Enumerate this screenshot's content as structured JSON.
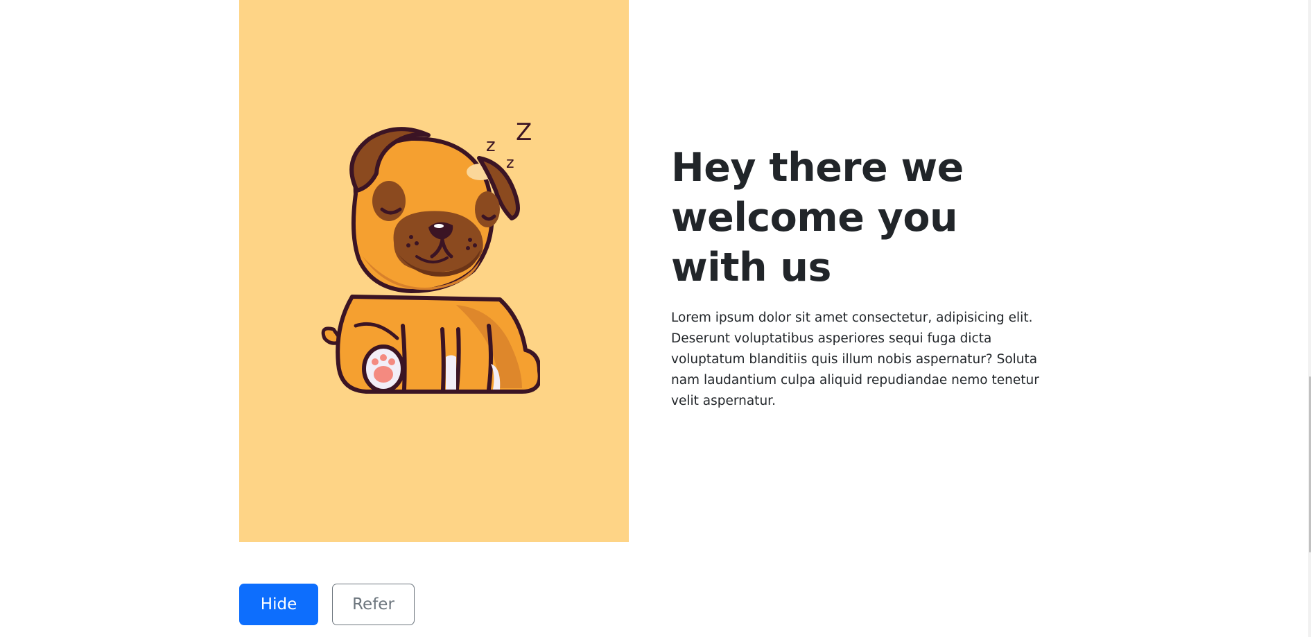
{
  "hero": {
    "image_alt": "sleeping puppy illustration",
    "image_background": "#fed486",
    "headline": "Hey there we welcome you with us",
    "body": "Lorem ipsum dolor sit amet consectetur, adipisicing elit. Deserunt voluptatibus asperiores sequi fuga dicta voluptatum blanditiis quis illum nobis aspernatur? Soluta nam laudantium culpa aliquid repudiandae nemo tenetur velit aspernatur."
  },
  "actions": {
    "hide_label": "Hide",
    "refer_label": "Refer",
    "primary_color": "#0d6efd",
    "secondary_color": "#6c757d"
  }
}
